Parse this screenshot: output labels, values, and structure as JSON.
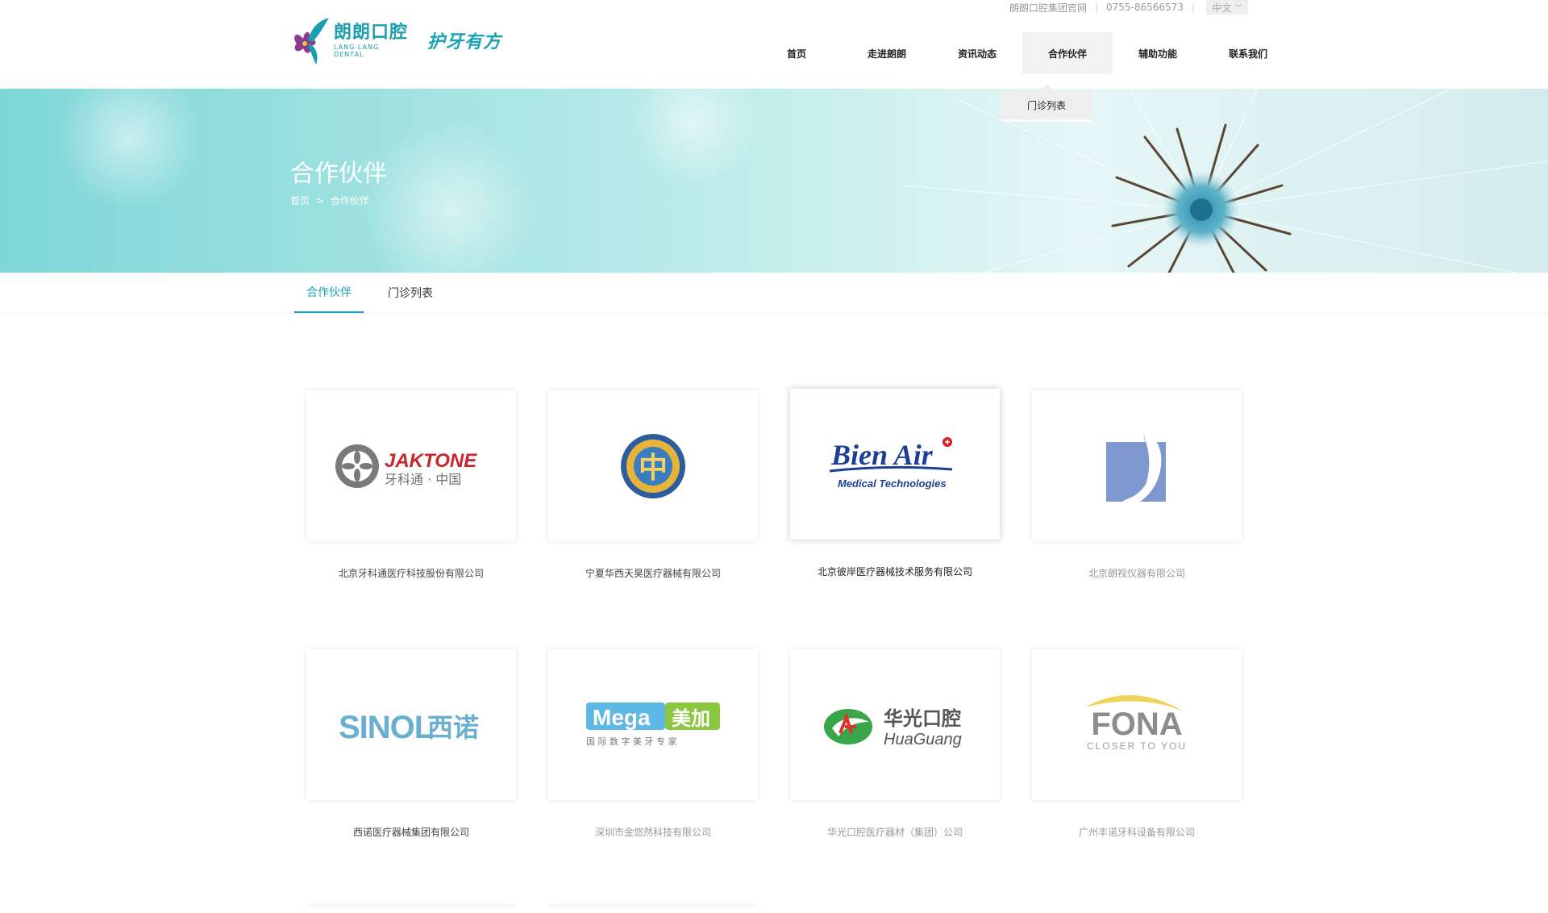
{
  "header": {
    "brand_cn": "朗朗口腔",
    "brand_en_1": "LANG LANG",
    "brand_en_2": "DENTAL",
    "slogan": "护牙有方",
    "topbar": {
      "group_site": "朗朗口腔集团官网",
      "phone": "0755-86566573",
      "lang": "中文"
    },
    "nav": [
      "首页",
      "走进朗朗",
      "资讯动态",
      "合作伙伴",
      "辅助功能",
      "联系我们"
    ],
    "nav_active_index": 3,
    "dropdown_item": "门诊列表"
  },
  "banner": {
    "title": "合作伙伴",
    "crumb_home": "首页",
    "crumb_sep": ">",
    "crumb_current": "合作伙伴"
  },
  "tabs": [
    "合作伙伴",
    "门诊列表"
  ],
  "partners": [
    {
      "name": "北京牙科通医疗科技股份有限公司",
      "logo_en": "JAKTONE",
      "logo_cn": "牙科通 · 中国"
    },
    {
      "name": "宁夏华西天昊医疗器械有限公司",
      "logo_cn": "中"
    },
    {
      "name": "北京彼岸医疗器械技术服务有限公司",
      "logo_en": "Bien Air",
      "logo_sub": "Medical Technologies"
    },
    {
      "name": "北京朗视仪器有限公司"
    },
    {
      "name": "西诺医疗器械集团有限公司",
      "logo_en": "SINOL",
      "logo_cn": "西诺"
    },
    {
      "name": "深圳市金悠然科技有限公司",
      "logo_en": "Mega",
      "logo_cn": "美加",
      "logo_sub": "国 际 数 字 美 牙 专 家"
    },
    {
      "name": "华光口腔医疗器材（集团）公司",
      "logo_cn": "华光口腔",
      "logo_en": "HuaGuang"
    },
    {
      "name": "广州丰诺牙科设备有限公司",
      "logo_en": "FONA",
      "logo_sub": "CLOSER TO YOU"
    }
  ],
  "colors": {
    "brand_teal": "#1aa3b4",
    "jaktone_red": "#c8262c",
    "bienair_blue": "#1c3f94",
    "sinol_blue": "#6aaed0",
    "mega_blue": "#5eb8e6",
    "mega_green": "#8dc63f",
    "huaguang_green": "#39a64a",
    "fona_gray": "#8c8c8c",
    "fona_yellow": "#f0d35a"
  }
}
